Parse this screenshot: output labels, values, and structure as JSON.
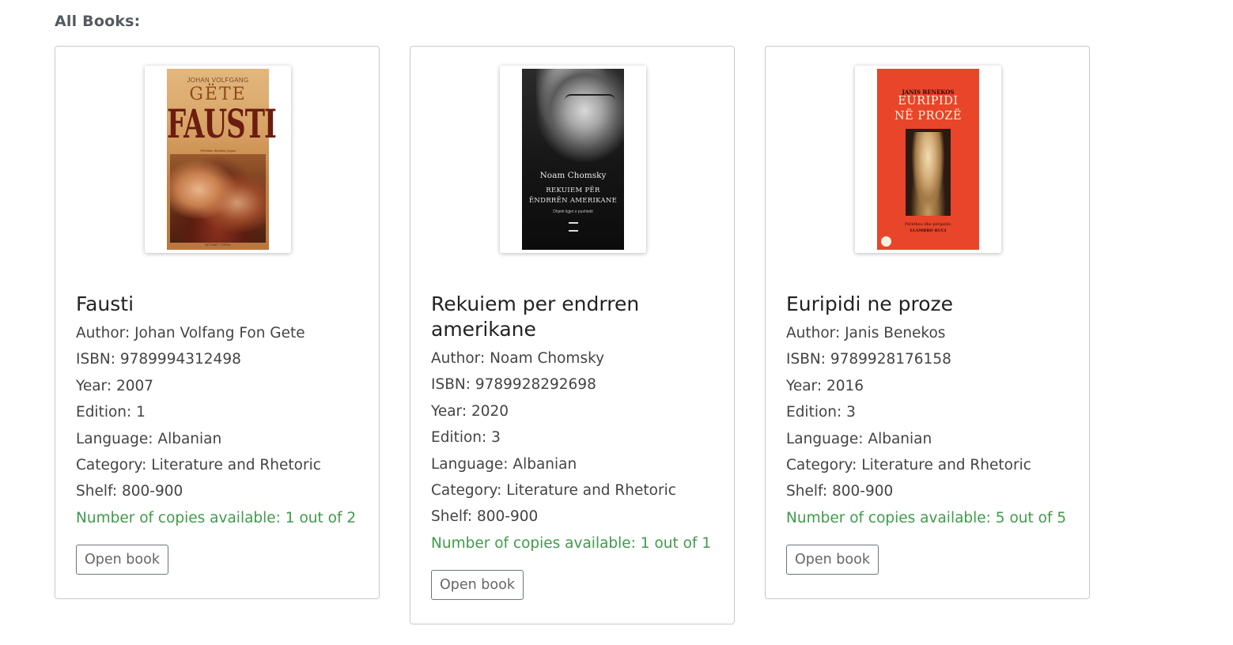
{
  "page": {
    "heading": "All Books:"
  },
  "books": [
    {
      "title": "Fausti",
      "author": "Author: Johan Volfang Fon Gete",
      "isbn": "ISBN: 9789994312498",
      "year": "Year: 2007",
      "edition": "Edition: 1",
      "language": "Language: Albanian",
      "category": "Category: Literature and Rhetoric",
      "shelf": "Shelf: 800-900",
      "copies": "Number of copies available: 1 out of 2",
      "button": "Open book",
      "cover": {
        "author": "JOHAN VOLFGANG",
        "name": "GËTE",
        "title": "FAUSTI",
        "subtitle": "Përktheu Shpëtim Çuçka",
        "publisher": "BOTIMET TOENA"
      }
    },
    {
      "title": "Rekuiem per endrren amerikane",
      "author": "Author: Noam Chomsky",
      "isbn": "ISBN: 9789928292698",
      "year": "Year: 2020",
      "edition": "Edition: 3",
      "language": "Language: Albanian",
      "category": "Category: Literature and Rhetoric",
      "shelf": "Shelf: 800-900",
      "copies": "Number of copies available: 1 out of 1",
      "button": "Open book",
      "cover": {
        "name": "Noam Chomsky",
        "title_line1": "REKUIEM PËR",
        "title_line2": "ËNDRRËN AMERIKANE",
        "tagline": "Dhjetë ligjet e pushtetit"
      }
    },
    {
      "title": "Euripidi ne proze",
      "author": "Author: Janis Benekos",
      "isbn": "ISBN: 9789928176158",
      "year": "Year: 2016",
      "edition": "Edition: 3",
      "language": "Language: Albanian",
      "category": "Category: Literature and Rhetoric",
      "shelf": "Shelf: 800-900",
      "copies": "Number of copies available: 5 out of 5",
      "button": "Open book",
      "cover": {
        "author": "JANIS BENEKOS",
        "title_line1": "EURIPIDI",
        "title_line2": "NË PROZË",
        "credit1": "Përktheu dhe përgatiti:",
        "credit2": "LLAMBRO RUCI"
      }
    }
  ],
  "colors": {
    "available": "#3f9b4a",
    "border": "#c9c9c9",
    "euripidi_cover": "#e8452a"
  }
}
